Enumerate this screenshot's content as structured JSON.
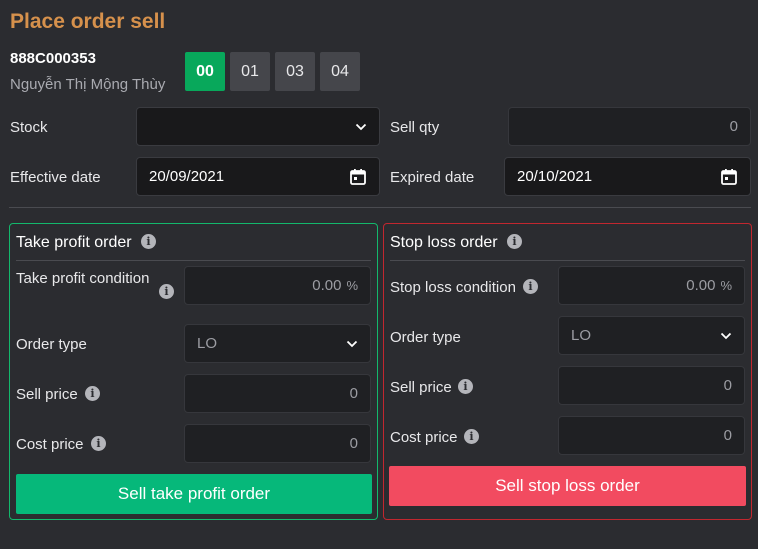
{
  "title": "Place order sell",
  "account": {
    "number": "888C000353",
    "name": "Nguyễn Thị Mộng Thùy",
    "sub_accounts": [
      "00",
      "01",
      "03",
      "04"
    ]
  },
  "form": {
    "stock_label": "Stock",
    "stock_value": "",
    "sell_qty_label": "Sell qty",
    "sell_qty_value": "0",
    "effective_date_label": "Effective date",
    "effective_date_value": "20/09/2021",
    "expired_date_label": "Expired date",
    "expired_date_value": "20/10/2021"
  },
  "take_profit": {
    "header": "Take profit order",
    "condition_label": "Take profit condition",
    "condition_value": "0.00",
    "condition_unit": "%",
    "order_type_label": "Order type",
    "order_type_value": "LO",
    "sell_price_label": "Sell price",
    "sell_price_value": "0",
    "cost_price_label": "Cost price",
    "cost_price_value": "0",
    "button_label": "Sell take profit order"
  },
  "stop_loss": {
    "header": "Stop loss order",
    "condition_label": "Stop loss condition",
    "condition_value": "0.00",
    "condition_unit": "%",
    "order_type_label": "Order type",
    "order_type_value": "LO",
    "sell_price_label": "Sell price",
    "sell_price_value": "0",
    "cost_price_label": "Cost price",
    "cost_price_value": "0",
    "button_label": "Sell stop loss order"
  },
  "colors": {
    "title": "#d6914c",
    "active_tab": "#08a85b",
    "take_profit_accent": "#06b87a",
    "stop_loss_accent": "#f24b60"
  }
}
